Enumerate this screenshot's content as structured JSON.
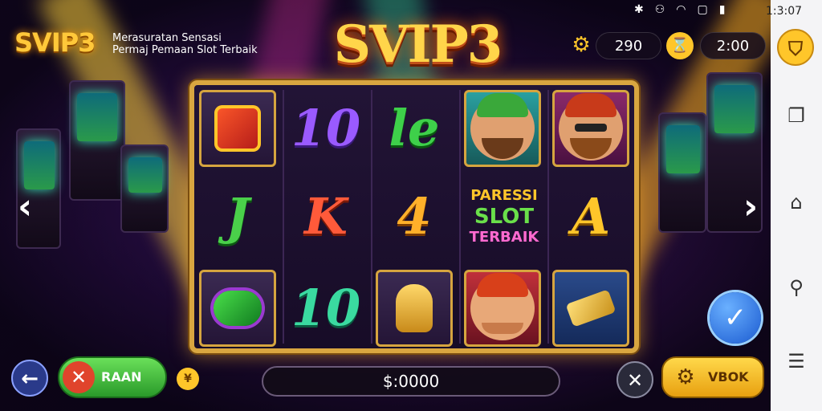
{
  "status_bar": {
    "time": "1:3:07",
    "icons": [
      "bluetooth-icon",
      "nfc-icon",
      "wifi-icon",
      "screen-icon",
      "battery-icon"
    ]
  },
  "header": {
    "brand": "SVIP3",
    "tagline_line1": "Merasuratan Sensasi",
    "tagline_line2": "Permaj Pemaan Slot Terbaik",
    "logo": "SVIP3",
    "coins": "290",
    "timer": "2:00"
  },
  "reels": {
    "symbols": [
      [
        "10",
        "10",
        "J",
        "K"
      ],
      [
        "le",
        "4",
        "A"
      ],
      [
        "10"
      ]
    ],
    "promo": {
      "line1": "PARESSI",
      "line2": "SLOT",
      "line3": "TERBAIK"
    }
  },
  "bottom": {
    "spin_label": "RAAN",
    "balance": "$:0000",
    "action_label": "VBOK"
  },
  "colors": {
    "accent": "#ffc62a",
    "green": "#3ec64a",
    "red": "#e0442c",
    "blue": "#2a7ae0",
    "frame": "#d9a640"
  }
}
